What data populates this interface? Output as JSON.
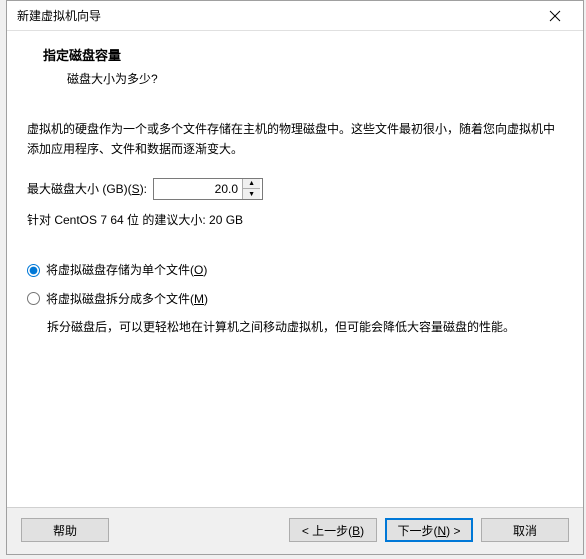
{
  "window": {
    "title": "新建虚拟机向导"
  },
  "header": {
    "title": "指定磁盘容量",
    "subtitle": "磁盘大小为多少?"
  },
  "intro": "虚拟机的硬盘作为一个或多个文件存储在主机的物理磁盘中。这些文件最初很小，随着您向虚拟机中添加应用程序、文件和数据而逐渐变大。",
  "disk": {
    "label_prefix": "最大磁盘大小 (GB)(",
    "label_key": "S",
    "label_suffix": "):",
    "value": "20.0",
    "recommend": "针对 CentOS 7 64 位 的建议大小: 20 GB"
  },
  "radio": {
    "single_prefix": "将虚拟磁盘存储为单个文件(",
    "single_key": "O",
    "single_suffix": ")",
    "split_prefix": "将虚拟磁盘拆分成多个文件(",
    "split_key": "M",
    "split_suffix": ")",
    "split_desc": "拆分磁盘后，可以更轻松地在计算机之间移动虚拟机，但可能会降低大容量磁盘的性能。"
  },
  "footer": {
    "help": "帮助",
    "back_prefix": "< 上一步(",
    "back_key": "B",
    "back_suffix": ")",
    "next_prefix": "下一步(",
    "next_key": "N",
    "next_suffix": ") >",
    "cancel": "取消"
  }
}
